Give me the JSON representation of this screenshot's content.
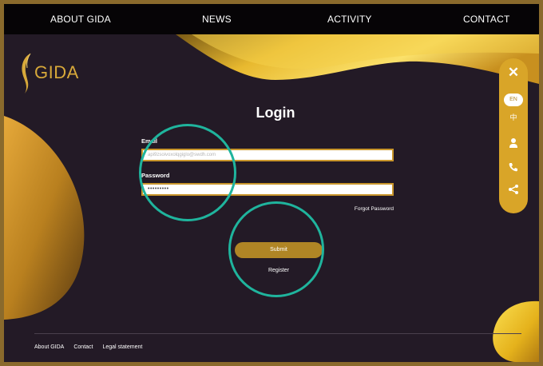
{
  "nav": {
    "items": [
      {
        "label": "ABOUT GIDA"
      },
      {
        "label": "NEWS"
      },
      {
        "label": "ACTIVITY"
      },
      {
        "label": "CONTACT"
      }
    ]
  },
  "logo": {
    "text": "GIDA",
    "icon": "feather-icon"
  },
  "login": {
    "title": "Login",
    "email_label": "Email",
    "email_value": "api9zsoivoxolqgiglo@swdh.com",
    "password_label": "Password",
    "password_value": "•••••••••",
    "forgot": "Forgot Password",
    "submit": "Submit",
    "register": "Register"
  },
  "sidebar": {
    "close_icon": "close-icon",
    "lang_en": "EN",
    "lang_zh": "中",
    "icons": [
      "user-icon",
      "phone-icon",
      "share-icon"
    ]
  },
  "footer": {
    "links": [
      "About GIDA",
      "Contact",
      "Legal statement"
    ]
  },
  "colors": {
    "background": "#231a26",
    "nav": "#060406",
    "gold": "#d9a528",
    "frame": "#8a6a2c",
    "highlight": "#1fb49d"
  }
}
